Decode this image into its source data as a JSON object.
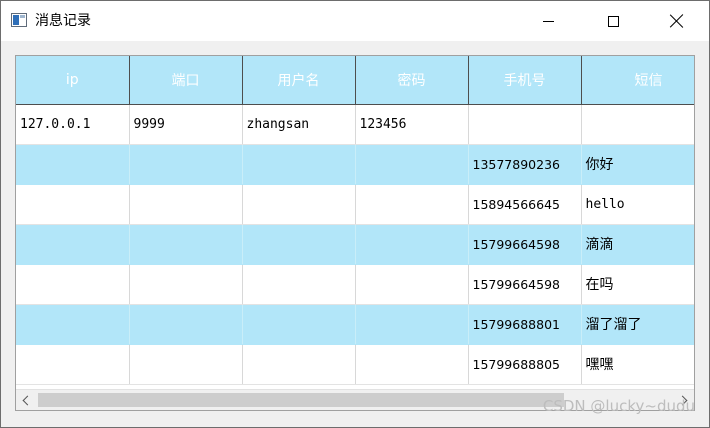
{
  "window": {
    "title": "消息记录"
  },
  "table": {
    "headers": [
      "ip",
      "端口",
      "用户名",
      "密码",
      "手机号",
      "短信"
    ],
    "rows": [
      [
        "127.0.0.1",
        "9999",
        "zhangsan",
        "123456",
        "",
        ""
      ],
      [
        "",
        "",
        "",
        "",
        "13577890236",
        "你好"
      ],
      [
        "",
        "",
        "",
        "",
        "15894566645",
        "hello"
      ],
      [
        "",
        "",
        "",
        "",
        "15799664598",
        "滴滴"
      ],
      [
        "",
        "",
        "",
        "",
        "15799664598",
        "在吗"
      ],
      [
        "",
        "",
        "",
        "",
        "15799688801",
        "溜了溜了"
      ],
      [
        "",
        "",
        "",
        "",
        "15799688805",
        "嘿嘿"
      ]
    ]
  },
  "colors": {
    "header_bg": "#b2e6f9",
    "alt_row_bg": "#b2e6f9"
  },
  "watermark": "CSDN @lucky~dudu"
}
